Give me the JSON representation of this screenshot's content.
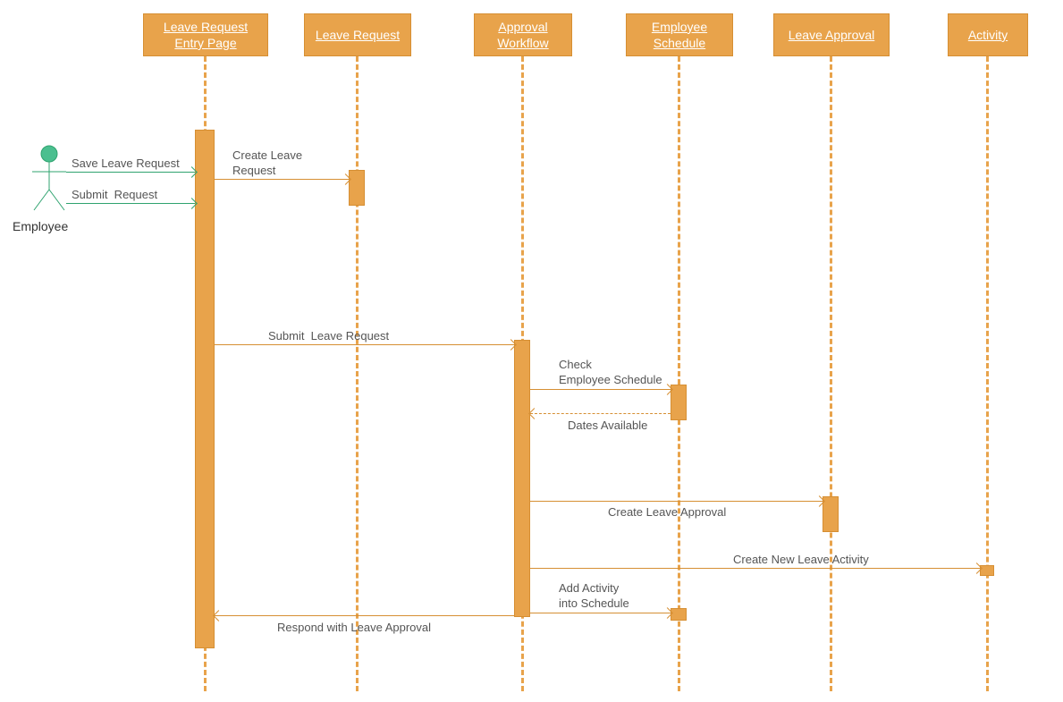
{
  "actor": {
    "label": "Employee"
  },
  "lifelines": {
    "entry": {
      "label": "Leave Request\nEntry Page"
    },
    "request": {
      "label": "Leave Request"
    },
    "workflow": {
      "label": "Approval\nWorkflow"
    },
    "schedule": {
      "label": "Employee\nSchedule"
    },
    "approval": {
      "label": "Leave Approval"
    },
    "activity": {
      "label": "Activity"
    }
  },
  "messages": {
    "save": "Save Leave Request",
    "submit": "Submit  Request",
    "create_request": "Create Leave\nRequest",
    "submit_leave": "Submit  Leave Request",
    "check_schedule": "Check\nEmployee Schedule",
    "dates_available": "Dates Available",
    "create_approval": "Create Leave Approval",
    "create_activity": "Create New Leave Activity",
    "add_activity": "Add Activity\ninto Schedule",
    "respond": "Respond with Leave Approval"
  }
}
